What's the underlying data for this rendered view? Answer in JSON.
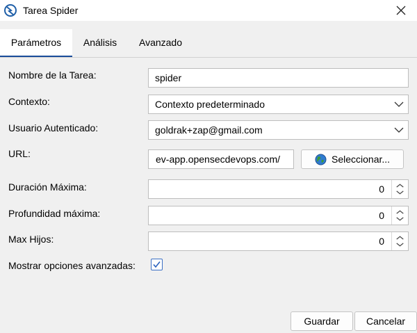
{
  "window": {
    "title": "Tarea Spider",
    "app_icon": "zap-icon",
    "close_icon": "close-icon"
  },
  "tabs": [
    {
      "label": "Parámetros",
      "active": true
    },
    {
      "label": "Análisis",
      "active": false
    },
    {
      "label": "Avanzado",
      "active": false
    }
  ],
  "form": {
    "task_name": {
      "label": "Nombre de la Tarea:",
      "value": "spider"
    },
    "context": {
      "label": "Contexto:",
      "value": "Contexto predeterminado"
    },
    "user": {
      "label": "Usuario Autenticado:",
      "value": "goldrak+zap@gmail.com"
    },
    "url": {
      "label": "URL:",
      "value": "ev-app.opensecdevops.com/",
      "select_label": "Seleccionar..."
    },
    "max_duration": {
      "label": "Duración Máxima:",
      "value": "0"
    },
    "max_depth": {
      "label": "Profundidad máxima:",
      "value": "0"
    },
    "max_children": {
      "label": "Max Hijos:",
      "value": "0"
    },
    "advanced": {
      "label": "Mostrar opciones avanzadas:",
      "checked": true
    }
  },
  "buttons": {
    "save": "Guardar",
    "cancel": "Cancelar"
  },
  "colors": {
    "accent": "#1a4c9a",
    "checkbox": "#3a6fc4"
  }
}
